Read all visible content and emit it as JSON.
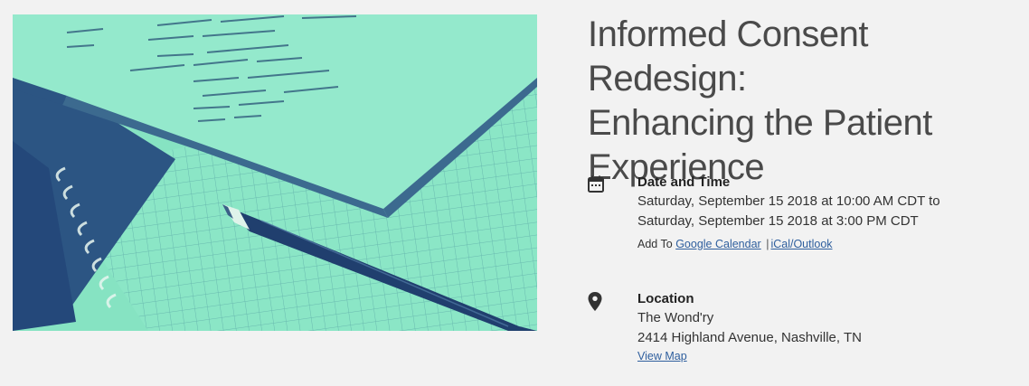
{
  "event": {
    "title_line1": "Informed Consent Redesign:",
    "title_line2": "Enhancing the Patient",
    "title_line3": "Experience"
  },
  "date_time": {
    "icon": "calendar-icon",
    "heading": "Date and Time",
    "start": "Saturday, September 15 2018 at 10:00 AM CDT to",
    "end": "Saturday, September 15 2018 at 3:00 PM CDT",
    "add_to_label": "Add To",
    "google_calendar_label": "Google Calendar",
    "separator": "|",
    "ical_label": "iCal/Outlook"
  },
  "location": {
    "icon": "map-pin-icon",
    "heading": "Location",
    "venue": "The Wond'ry",
    "address": "2414 Highland Avenue, Nashville, TN",
    "view_map_label": "View Map"
  },
  "colors": {
    "background": "#f2f2f2",
    "image_tint": "#7fe0bd",
    "image_dark": "#2a4f7e",
    "link": "#2f5f9e",
    "title": "#4a4a4a"
  }
}
